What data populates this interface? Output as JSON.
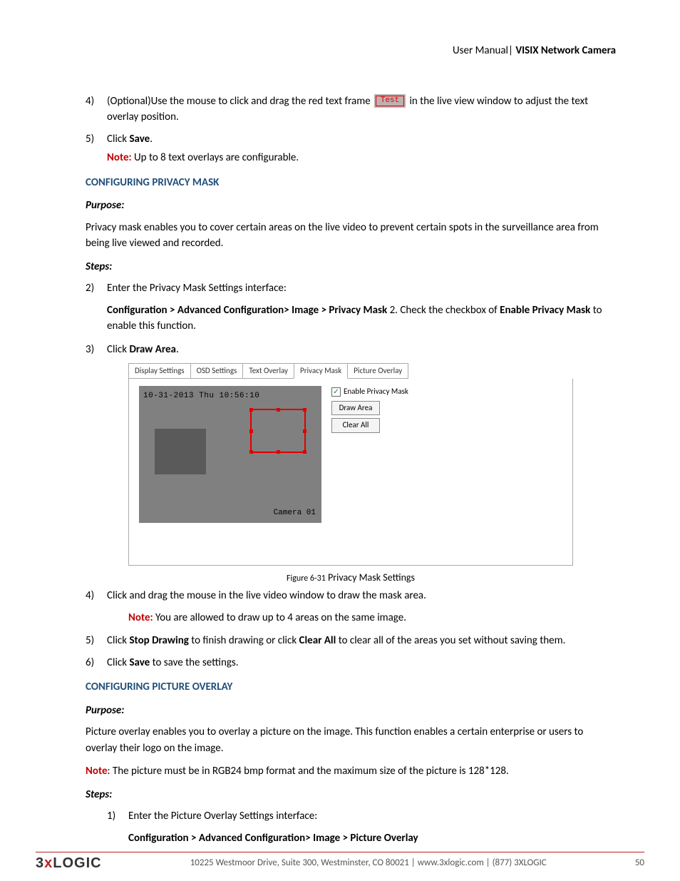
{
  "header": {
    "left": "User Manual",
    "sep": "|",
    "right": "VISIX Network Camera"
  },
  "step4": {
    "num": "4)",
    "pre": "(Optional)Use the mouse to click and drag the red text frame ",
    "test_label": "Test",
    "post": " in the live view window to adjust the text overlay position."
  },
  "step5": {
    "num": "5)",
    "text_a": "Click ",
    "text_b": "Save",
    "text_c": ".",
    "note_label": "Note:",
    "note_text": " Up to 8 text overlays are configurable."
  },
  "privacy": {
    "heading": "CONFIGURING PRIVACY MASK",
    "purpose_label": "Purpose:",
    "purpose_text": "Privacy mask enables you to cover certain areas on the live video to prevent certain spots in the surveillance area from being live viewed and recorded.",
    "steps_label": "Steps:",
    "s2": {
      "num": "2)",
      "text": "Enter the Privacy Mask Settings interface:"
    },
    "s2b": {
      "path": "Configuration > Advanced Configuration> Image > Privacy Mask",
      "tail_a": " 2. Check the checkbox of ",
      "tail_b": "Enable Privacy Mask",
      "tail_c": " to enable this function."
    },
    "s3": {
      "num": "3)",
      "a": "Click ",
      "b": "Draw Area",
      "c": "."
    },
    "figure": {
      "tabs": [
        "Display Settings",
        "OSD Settings",
        "Text Overlay",
        "Privacy Mask",
        "Picture Overlay"
      ],
      "active_tab": "Privacy Mask",
      "timestamp": "10-31-2013 Thu 10:56:10",
      "camera_label": "Camera 01",
      "checkbox_label": "Enable Privacy Mask",
      "btn_draw": "Draw Area",
      "btn_clear": "Clear All",
      "caption_a": "Figure 6-31",
      "caption_b": " Privacy Mask Settings"
    },
    "s4": {
      "num": "4)",
      "text": "Click and drag the mouse in the live video window to draw the mask area."
    },
    "s4note": {
      "label": "Note:",
      "text": " You are allowed to draw up to 4 areas on the same image."
    },
    "s5": {
      "num": "5)",
      "a": "Click ",
      "b": "Stop Drawing",
      "c": " to finish drawing or click ",
      "d": "Clear All",
      "e": " to clear all of the areas you set without saving them."
    },
    "s6": {
      "num": "6)",
      "a": "Click ",
      "b": "Save",
      "c": " to save the settings."
    }
  },
  "overlay": {
    "heading": "CONFIGURING PICTURE OVERLAY",
    "purpose_label": "Purpose:",
    "purpose_text": "Picture overlay enables you to overlay a picture on the image. This function enables a certain enterprise or users to overlay their logo on the image.",
    "note_label": "Note",
    "note_text": ": The picture must be in RGB24 bmp format and the maximum size of the picture is 128*128.",
    "steps_label": "Steps:",
    "s1": {
      "num": "1)",
      "text": "Enter the Picture Overlay Settings interface:"
    },
    "s1b": "Configuration > Advanced Configuration> Image > Picture Overlay"
  },
  "footer": {
    "logo_a": "3",
    "logo_b": "x",
    "logo_c": "LOGIC",
    "address": "10225 Westmoor Drive, Suite 300, Westminster, CO 80021 | www.3xlogic.com | (877) 3XLOGIC",
    "page": "50"
  }
}
